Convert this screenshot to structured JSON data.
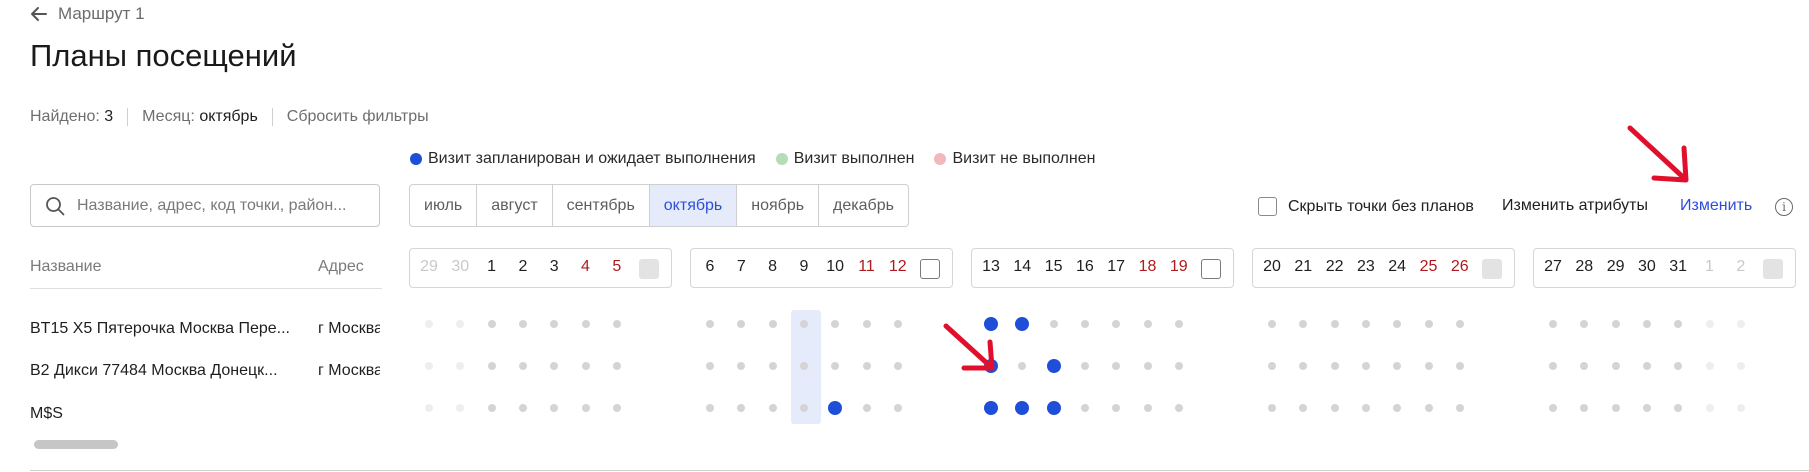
{
  "back": {
    "label": "Маршрут 1"
  },
  "page": {
    "title": "Планы посещений"
  },
  "stats": {
    "found_label": "Найдено:",
    "found_value": "3",
    "month_label": "Месяц:",
    "month_value": "октябрь",
    "reset_label": "Сбросить фильтры"
  },
  "legend": [
    {
      "label": "Визит запланирован и ожидает выполнения",
      "color": "#1f4fd8"
    },
    {
      "label": "Визит выполнен",
      "color": "#b6dcb6"
    },
    {
      "label": "Визит не выполнен",
      "color": "#f2b8bb"
    }
  ],
  "search": {
    "placeholder": "Название, адрес, код точки, район..."
  },
  "months": {
    "items": [
      "июль",
      "август",
      "сентябрь",
      "октябрь",
      "ноябрь",
      "декабрь"
    ],
    "selected": "октябрь"
  },
  "actions": {
    "hide_empty_label": "Скрыть точки без планов",
    "hide_empty_checked": false,
    "edit_attributes_label": "Изменить атрибуты",
    "edit_label": "Изменить",
    "info_icon": "info-icon"
  },
  "table": {
    "headers": {
      "name": "Название",
      "address": "Адрес"
    },
    "rows": [
      {
        "name": "BT15 X5 Пятерочка Москва Пере...",
        "address": "г Москва"
      },
      {
        "name": "B2 Дикси 77484 Москва Донецк...",
        "address": "г Москва"
      },
      {
        "name": "M$S",
        "address": ""
      }
    ]
  },
  "calendar": {
    "weeks": [
      {
        "days": [
          {
            "d": "29",
            "s": "out"
          },
          {
            "d": "30",
            "s": "out"
          },
          {
            "d": "1",
            "s": "wd"
          },
          {
            "d": "2",
            "s": "wd"
          },
          {
            "d": "3",
            "s": "wd"
          },
          {
            "d": "4",
            "s": "we"
          },
          {
            "d": "5",
            "s": "we"
          }
        ],
        "checkbox": "disabled"
      },
      {
        "days": [
          {
            "d": "6",
            "s": "wd"
          },
          {
            "d": "7",
            "s": "wd"
          },
          {
            "d": "8",
            "s": "wd"
          },
          {
            "d": "9",
            "s": "wd"
          },
          {
            "d": "10",
            "s": "wd"
          },
          {
            "d": "11",
            "s": "we"
          },
          {
            "d": "12",
            "s": "we"
          }
        ],
        "checkbox": "enabled"
      },
      {
        "days": [
          {
            "d": "13",
            "s": "wd"
          },
          {
            "d": "14",
            "s": "wd"
          },
          {
            "d": "15",
            "s": "wd"
          },
          {
            "d": "16",
            "s": "wd"
          },
          {
            "d": "17",
            "s": "wd"
          },
          {
            "d": "18",
            "s": "we"
          },
          {
            "d": "19",
            "s": "we"
          }
        ],
        "checkbox": "enabled"
      },
      {
        "days": [
          {
            "d": "20",
            "s": "wd"
          },
          {
            "d": "21",
            "s": "wd"
          },
          {
            "d": "22",
            "s": "wd"
          },
          {
            "d": "23",
            "s": "wd"
          },
          {
            "d": "24",
            "s": "wd"
          },
          {
            "d": "25",
            "s": "we"
          },
          {
            "d": "26",
            "s": "we"
          }
        ],
        "checkbox": "disabled"
      },
      {
        "days": [
          {
            "d": "27",
            "s": "wd"
          },
          {
            "d": "28",
            "s": "wd"
          },
          {
            "d": "29",
            "s": "wd"
          },
          {
            "d": "30",
            "s": "wd"
          },
          {
            "d": "31",
            "s": "wd"
          },
          {
            "d": "1",
            "s": "out"
          },
          {
            "d": "2",
            "s": "out"
          }
        ],
        "checkbox": "disabled"
      }
    ],
    "highlighted_day": "9",
    "planned_visits": [
      {
        "row": 0,
        "days": [
          "13",
          "14"
        ]
      },
      {
        "row": 1,
        "days": [
          "13",
          "15"
        ]
      },
      {
        "row": 2,
        "days": [
          "10",
          "13",
          "14",
          "15"
        ]
      }
    ]
  },
  "colors": {
    "accent": "#2c4fd7",
    "planned": "#1f4fd8",
    "weekend": "#b0191e",
    "annotation_arrow": "#e0102c"
  }
}
